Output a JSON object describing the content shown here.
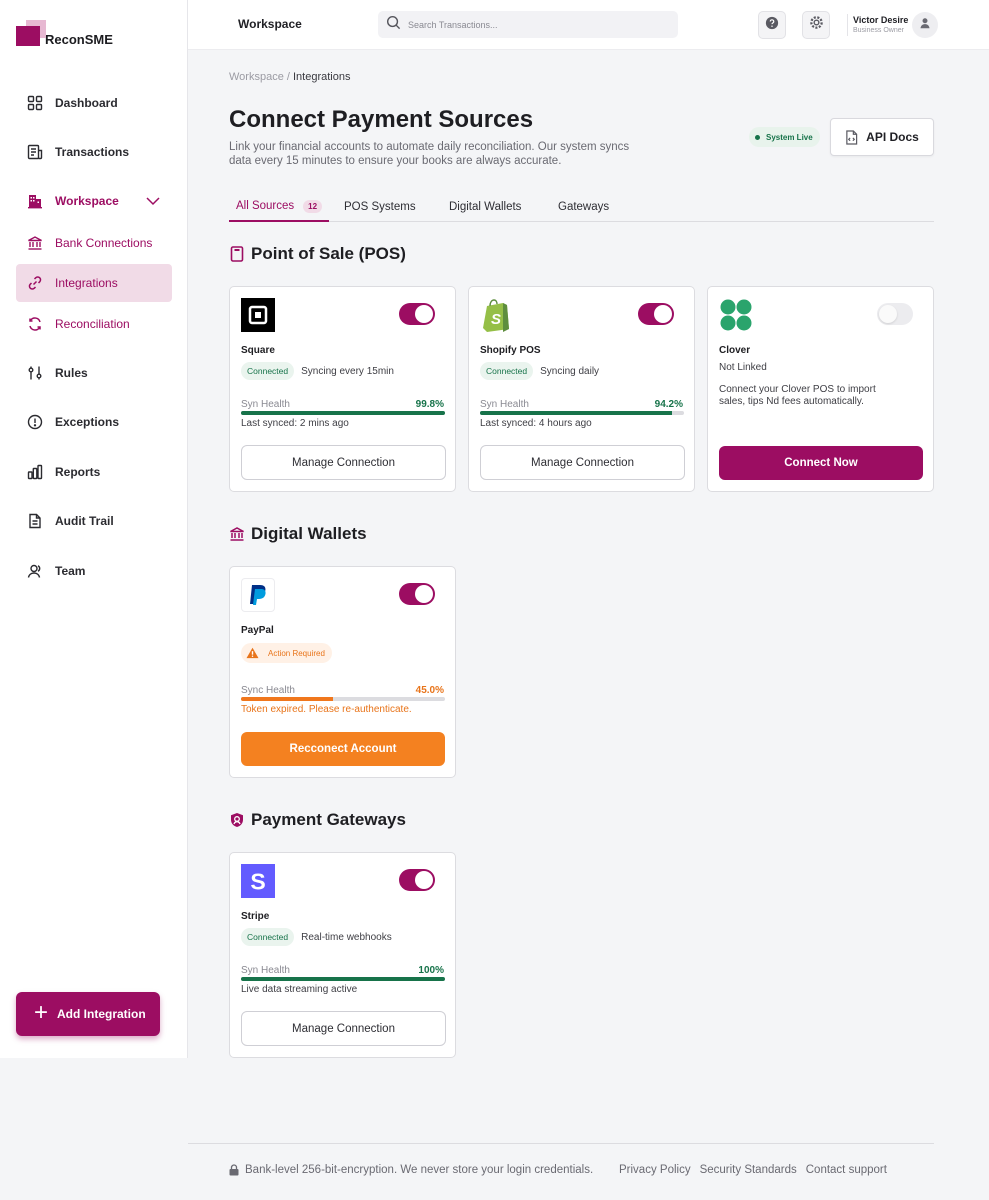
{
  "app": {
    "name": "ReconSME"
  },
  "sidebar": {
    "items": [
      {
        "label": "Dashboard",
        "icon": "grid-icon"
      },
      {
        "label": "Transactions",
        "icon": "receipt-icon"
      },
      {
        "label": "Workspace",
        "icon": "building-icon"
      },
      {
        "label": "Bank Connections",
        "icon": "bank-icon"
      },
      {
        "label": "Integrations",
        "icon": "link-icon"
      },
      {
        "label": "Reconciliation",
        "icon": "refresh-icon"
      },
      {
        "label": "Rules",
        "icon": "sliders-icon"
      },
      {
        "label": "Exceptions",
        "icon": "alert-circle-icon"
      },
      {
        "label": "Reports",
        "icon": "bar-chart-icon"
      },
      {
        "label": "Audit Trail",
        "icon": "document-icon"
      },
      {
        "label": "Team",
        "icon": "users-icon"
      }
    ],
    "add_button": "Add Integration"
  },
  "topbar": {
    "title": "Workspace",
    "search_placeholder": "Search Transactions...",
    "user_name": "Victor Desire",
    "user_role": "Business Owner"
  },
  "breadcrumb": {
    "parent": "Workspace",
    "separator": " / ",
    "current": "Integrations"
  },
  "page": {
    "title": "Connect Payment Sources",
    "subtitle": "Link your financial accounts to automate daily reconciliation. Our system syncs data every 15 minutes to ensure your books are always accurate.",
    "status": "System Live",
    "api_docs": "API Docs"
  },
  "tabs": [
    {
      "label": "All Sources",
      "badge": "12"
    },
    {
      "label": "POS Systems"
    },
    {
      "label": "Digital Wallets"
    },
    {
      "label": "Gateways"
    }
  ],
  "sections": {
    "pos": "Point of Sale (POS)",
    "wallets": "Digital Wallets",
    "gateways": "Payment Gateways"
  },
  "cards": {
    "square": {
      "name": "Square",
      "status": "Connected",
      "note": "Syncing every 15min",
      "health_label": "Syn Health",
      "health_value": "99.8%",
      "health": 0.998,
      "sub": "Last synced: 2 mins ago",
      "button": "Manage Connection",
      "enabled": true
    },
    "shopify": {
      "name": "Shopify POS",
      "status": "Connected",
      "note": "Syncing daily",
      "health_label": "Syn Health",
      "health_value": "94.2%",
      "health": 0.942,
      "sub": "Last synced: 4 hours ago",
      "button": "Manage Connection",
      "enabled": true
    },
    "clover": {
      "name": "Clover",
      "status": "Not Linked",
      "description": "Connect your Clover POS to import sales, tips Nd fees automatically.",
      "button": "Connect Now",
      "enabled": false
    },
    "paypal": {
      "name": "PayPal",
      "status": "Action Required",
      "health_label": "Sync Health",
      "health_value": "45.0%",
      "health": 0.45,
      "sub": "Token expired. Please re-authenticate.",
      "button": "Recconect Account",
      "enabled": true
    },
    "stripe": {
      "name": "Stripe",
      "status": "Connected",
      "note": "Real-time webhooks",
      "health_label": "Syn Health",
      "health_value": "100%",
      "health": 1.0,
      "sub": "Live data streaming active",
      "button": "Manage Connection",
      "enabled": true
    }
  },
  "footer": {
    "note": "Bank-level 256-bit-encryption. We never store your login credentials.",
    "links": [
      "Privacy Policy",
      "Security Standards",
      "Contact support"
    ]
  },
  "colors": {
    "brand": "#9c0d62",
    "success": "#17734a",
    "warning": "#f48120"
  }
}
